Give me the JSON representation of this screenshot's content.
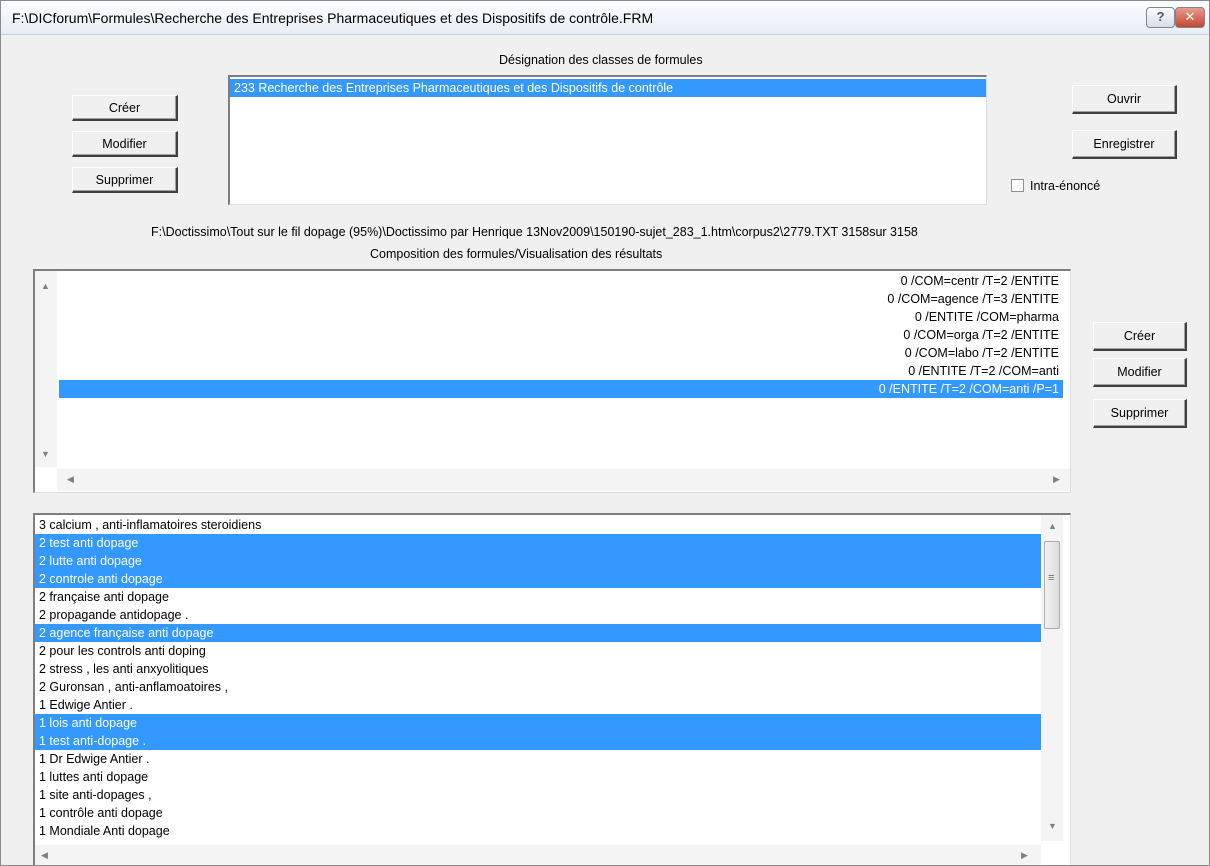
{
  "window": {
    "title": "F:\\DICforum\\Formules\\Recherche des Entreprises Pharmaceutiques et des Dispositifs de contrôle.FRM",
    "help_glyph": "?",
    "close_glyph": "✕"
  },
  "classes": {
    "header": "Désignation des classes de formules",
    "items": [
      {
        "text": "233  Recherche des Entreprises Pharmaceutiques et des Dispositifs de contrôle",
        "selected": true
      }
    ]
  },
  "left_buttons": {
    "create": "Créer",
    "modify": "Modifier",
    "delete": "Supprimer"
  },
  "right_buttons": {
    "open": "Ouvrir",
    "save": "Enregistrer"
  },
  "intra": {
    "label": "Intra-énoncé",
    "checked": false
  },
  "path_line": "F:\\Doctissimo\\Tout sur le fil dopage (95%)\\Doctissimo par Henrique 13Nov2009\\150190-sujet_283_1.htm\\corpus2\\2779.TXT 3158sur 3158",
  "composition": {
    "header": "Composition des formules/Visualisation des résultats",
    "items": [
      {
        "text": "0  /COM=centr /T=2 /ENTITE",
        "selected": false
      },
      {
        "text": "0  /COM=agence /T=3 /ENTITE",
        "selected": false
      },
      {
        "text": "0  /ENTITE /COM=pharma",
        "selected": false
      },
      {
        "text": "0  /COM=orga /T=2 /ENTITE",
        "selected": false
      },
      {
        "text": "0  /COM=labo /T=2 /ENTITE",
        "selected": false
      },
      {
        "text": "0  /ENTITE /T=2 /COM=anti",
        "selected": false
      },
      {
        "text": "0  /ENTITE /T=2 /COM=anti /P=1",
        "selected": true
      }
    ]
  },
  "formula_buttons": {
    "create": "Créer",
    "modify": "Modifier",
    "delete": "Supprimer"
  },
  "results": {
    "items": [
      {
        "text": "3  calcium , anti-inflamatoires steroidiens",
        "selected": false
      },
      {
        "text": "2  test anti dopage",
        "selected": true
      },
      {
        "text": "2  lutte anti dopage",
        "selected": true
      },
      {
        "text": "2  controle anti dopage",
        "selected": true
      },
      {
        "text": "2  française anti dopage",
        "selected": false
      },
      {
        "text": "2  propagande antidopage .",
        "selected": false
      },
      {
        "text": "2  agence française anti dopage",
        "selected": true
      },
      {
        "text": "2  pour les controls anti doping",
        "selected": false
      },
      {
        "text": "2  stress , les anti anxyolitiques",
        "selected": false
      },
      {
        "text": "2  Guronsan , anti-anflamoatoires ,",
        "selected": false
      },
      {
        "text": "1  Edwige Antier .",
        "selected": false
      },
      {
        "text": "1  lois anti dopage",
        "selected": true
      },
      {
        "text": "1  test anti-dopage .",
        "selected": true
      },
      {
        "text": "1  Dr Edwige Antier .",
        "selected": false
      },
      {
        "text": "1  luttes anti dopage",
        "selected": false
      },
      {
        "text": "1  site anti-dopages ,",
        "selected": false
      },
      {
        "text": "1  contrôle anti dopage",
        "selected": false
      },
      {
        "text": "1  Mondiale Anti dopage",
        "selected": false
      }
    ]
  },
  "scroll_glyphs": {
    "up": "▲",
    "down": "▼",
    "left": "◀",
    "right": "▶",
    "grip": "≡"
  }
}
